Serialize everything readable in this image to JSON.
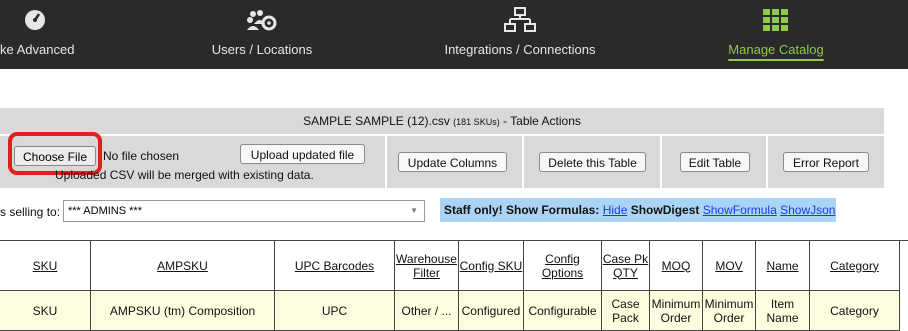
{
  "nav": {
    "items": [
      {
        "label": "ke Advanced",
        "icon": "gauge-icon"
      },
      {
        "label": "Users / Locations",
        "icon": "users-gear-icon"
      },
      {
        "label": "Integrations / Connections",
        "icon": "network-icon"
      },
      {
        "label": "Manage Catalog",
        "icon": "grid-icon",
        "active": true
      }
    ]
  },
  "actions": {
    "title_main": "SAMPLE SAMPLE (12).csv",
    "title_count": "(181 SKUs)",
    "title_suffix": "- Table Actions",
    "choose_file": "Choose File",
    "no_file": "No file chosen",
    "upload_button": "Upload updated file",
    "merge_note": "Uploaded CSV will be merged with existing data.",
    "update_columns": "Update Columns",
    "delete_table": "Delete this Table",
    "edit_table": "Edit Table",
    "error_report": "Error Report"
  },
  "selling": {
    "label": "s selling to:",
    "value": "*** ADMINS ***"
  },
  "staff": {
    "prefix": "Staff only! Show Formulas:",
    "hide": "Hide",
    "show_digest": "ShowDigest",
    "show_formula": "ShowFormula",
    "show_json": "ShowJson"
  },
  "table": {
    "headers": [
      "SKU",
      "AMPSKU",
      "UPC Barcodes",
      "Warehouse Filter",
      "Config SKU",
      "Config Options",
      "Case Pk QTY",
      "MOQ",
      "MOV",
      "Name",
      "Category"
    ],
    "row1": [
      "SKU",
      "AMPSKU (tm) Composition",
      "UPC",
      "Other / ...",
      "Configured",
      "Configurable",
      "Case Pack",
      "Minimum Order",
      "Minimum Order",
      "Item Name",
      "Category"
    ]
  },
  "colors": {
    "nav_bg": "#2a2a2a",
    "active": "#8fc94a",
    "panel": "#d9d9d9",
    "staff_bg": "#a9d4f5",
    "highlight": "#e02020"
  }
}
